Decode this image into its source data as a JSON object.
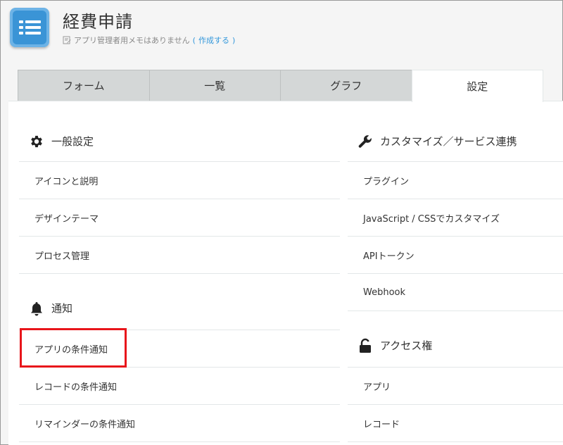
{
  "app": {
    "title": "経費申請",
    "memo_text": "アプリ管理者用メモはありません",
    "memo_link_open": "(",
    "memo_link": "作成する",
    "memo_link_close": ")"
  },
  "tabs": [
    {
      "label": "フォーム",
      "active": false
    },
    {
      "label": "一覧",
      "active": false
    },
    {
      "label": "グラフ",
      "active": false
    },
    {
      "label": "設定",
      "active": true
    }
  ],
  "sections": {
    "general": {
      "title": "一般設定",
      "icon": "gear-icon",
      "items": [
        "アイコンと説明",
        "デザインテーマ",
        "プロセス管理"
      ]
    },
    "notify": {
      "title": "通知",
      "icon": "bell-icon",
      "items": [
        "アプリの条件通知",
        "レコードの条件通知",
        "リマインダーの条件通知"
      ]
    },
    "customize": {
      "title": "カスタマイズ／サービス連携",
      "icon": "wrench-icon",
      "items": [
        "プラグイン",
        "JavaScript / CSSでカスタマイズ",
        "APIトークン",
        "Webhook"
      ]
    },
    "access": {
      "title": "アクセス権",
      "icon": "lock-icon",
      "items": [
        "アプリ",
        "レコード"
      ]
    }
  },
  "colors": {
    "accent": "#3498db",
    "highlight": "#e8151b",
    "tab_inactive": "#d4d7d7"
  }
}
